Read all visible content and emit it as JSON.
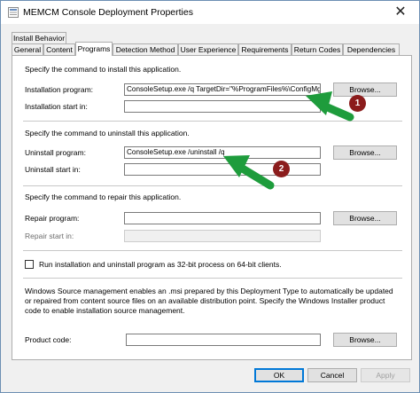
{
  "window": {
    "title": "MEMCM Console Deployment Properties",
    "close_glyph": "✕"
  },
  "tabs_top": [
    {
      "label": "Install Behavior"
    }
  ],
  "tabs": [
    {
      "label": "General"
    },
    {
      "label": "Content"
    },
    {
      "label": "Programs"
    },
    {
      "label": "Detection Method"
    },
    {
      "label": "User Experience"
    },
    {
      "label": "Requirements"
    },
    {
      "label": "Return Codes"
    },
    {
      "label": "Dependencies"
    }
  ],
  "install": {
    "heading": "Specify the command to install this application.",
    "program_label": "Installation program:",
    "program_value": "ConsoleSetup.exe /q TargetDir=\"%ProgramFiles%\\ConfigMgr C",
    "start_label": "Installation start in:",
    "start_value": "",
    "browse": "Browse..."
  },
  "uninstall": {
    "heading": "Specify the command to uninstall this application.",
    "program_label": "Uninstall program:",
    "program_value": "ConsoleSetup.exe /uninstall /q",
    "start_label": "Uninstall start in:",
    "start_value": "",
    "browse": "Browse..."
  },
  "repair": {
    "heading": "Specify the command to repair this application.",
    "program_label": "Repair program:",
    "program_value": "",
    "start_label": "Repair start in:",
    "start_value": "",
    "browse": "Browse..."
  },
  "option_32bit": {
    "label": "Run installation and uninstall program as 32-bit process on 64-bit clients.",
    "checked": false
  },
  "source_mgmt": {
    "description": "Windows Source management enables an .msi prepared by this Deployment Type to automatically be updated or repaired from content source files on an available distribution point. Specify the Windows Installer product code to enable installation source management.",
    "product_code_label": "Product code:",
    "product_code_value": "",
    "browse": "Browse..."
  },
  "footer": {
    "ok": "OK",
    "cancel": "Cancel",
    "apply": "Apply"
  },
  "annotations": [
    {
      "number": "1"
    },
    {
      "number": "2"
    }
  ],
  "colors": {
    "arrow": "#1e9c3c",
    "marker": "#8b1c1c",
    "accent": "#0078d7"
  }
}
